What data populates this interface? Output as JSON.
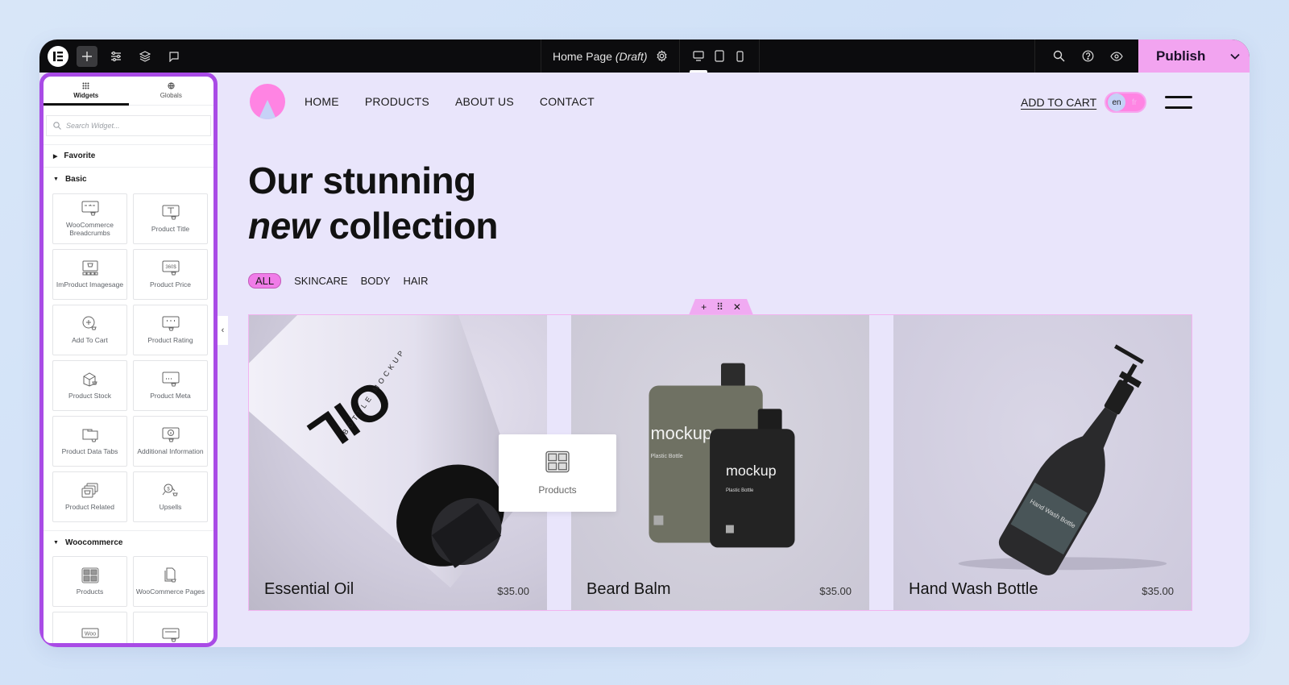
{
  "topbar": {
    "logo": "elementor-logo",
    "left_buttons": [
      {
        "name": "add-element-button",
        "icon": "plus-icon",
        "active": true
      },
      {
        "name": "site-settings-button",
        "icon": "sliders-icon"
      },
      {
        "name": "structure-button",
        "icon": "layers-icon"
      },
      {
        "name": "comments-button",
        "icon": "comment-icon"
      }
    ],
    "page_title": "Home Page",
    "page_status": "(Draft)",
    "page_settings_icon": "gear-icon",
    "devices": [
      {
        "name": "desktop",
        "icon": "desktop-icon",
        "active": true
      },
      {
        "name": "tablet",
        "icon": "tablet-icon"
      },
      {
        "name": "mobile",
        "icon": "mobile-icon"
      }
    ],
    "right_icons": [
      "search-icon",
      "help-icon",
      "preview-eye-icon"
    ],
    "publish_label": "Publish",
    "publish_color": "#f2a4f0"
  },
  "sidebar": {
    "border_color": "#a94be6",
    "tabs": [
      {
        "label": "Widgets",
        "icon": "grid-dots-icon",
        "active": true
      },
      {
        "label": "Globals",
        "icon": "globe-icon",
        "active": false
      }
    ],
    "search_placeholder": "Search Widget...",
    "sections": [
      {
        "label": "Favorite",
        "expanded": false,
        "widgets": []
      },
      {
        "label": "Basic",
        "expanded": true,
        "widgets": [
          {
            "label": "WooCommerce Breadcrumbs",
            "icon": "breadcrumbs-icon"
          },
          {
            "label": "Product Title",
            "icon": "product-title-icon"
          },
          {
            "label": "ImProduct Imagesage",
            "icon": "product-image-icon"
          },
          {
            "label": "Product Price",
            "icon": "product-price-icon"
          },
          {
            "label": "Add To Cart",
            "icon": "add-to-cart-icon"
          },
          {
            "label": "Product Rating",
            "icon": "product-rating-icon"
          },
          {
            "label": "Product Stock",
            "icon": "product-stock-icon"
          },
          {
            "label": "Product Meta",
            "icon": "product-meta-icon"
          },
          {
            "label": "Product Data Tabs",
            "icon": "product-data-tabs-icon"
          },
          {
            "label": "Additional Information",
            "icon": "additional-info-icon"
          },
          {
            "label": "Product Related",
            "icon": "product-related-icon"
          },
          {
            "label": "Upsells",
            "icon": "upsells-icon"
          }
        ]
      },
      {
        "label": "Woocommerce",
        "expanded": true,
        "widgets": [
          {
            "label": "Products",
            "icon": "products-grid-icon"
          },
          {
            "label": "WooCommerce Pages",
            "icon": "woocommerce-pages-icon"
          },
          {
            "label": "",
            "icon": "woo-icon"
          },
          {
            "label": "",
            "icon": "menu-cart-icon"
          }
        ]
      }
    ]
  },
  "site": {
    "nav": [
      "HOME",
      "PRODUCTS",
      "ABOUT US",
      "CONTACT"
    ],
    "add_to_cart": "ADD TO CART",
    "lang_active": "en",
    "lang_other": "fr",
    "hero_line1": "Our stunning",
    "hero_line2_em": "new",
    "hero_line2_rest": " collection",
    "filters": [
      {
        "label": "ALL",
        "active": true
      },
      {
        "label": "SKINCARE",
        "active": false
      },
      {
        "label": "BODY",
        "active": false
      },
      {
        "label": "HAIR",
        "active": false
      }
    ],
    "section_controls": [
      "+",
      "⠿",
      "✕"
    ],
    "products": [
      {
        "name": "Essential Oil",
        "price": "$35.00",
        "image_text": "OIL",
        "image_subtext": "BOTTLE MOCKUP"
      },
      {
        "name": "Beard Balm",
        "price": "$35.00",
        "image_text": "mockup",
        "image_subtext": "Plastic Bottle"
      },
      {
        "name": "Hand Wash Bottle",
        "price": "$35.00",
        "image_text": "Hand Wash Bottle",
        "image_subtext": ""
      }
    ],
    "drag_widget_label": "Products",
    "accent_pink": "#ff84e3",
    "accent_blue": "#c6d2f7"
  }
}
